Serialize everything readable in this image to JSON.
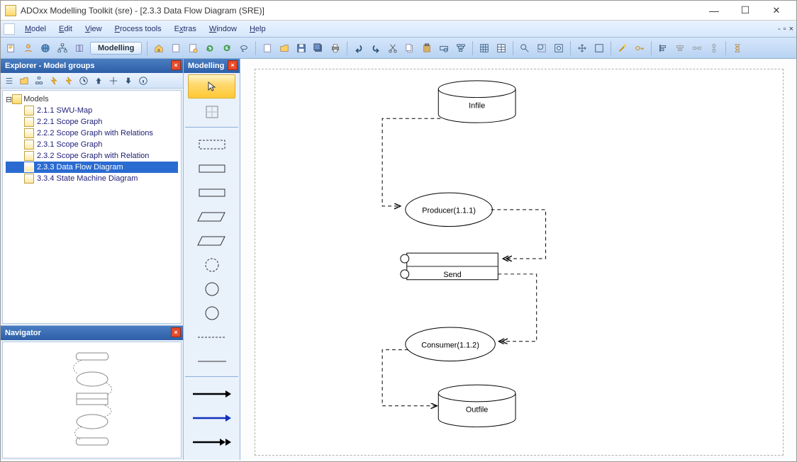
{
  "title": "ADOxx Modelling Toolkit (sre) - [2.3.3 Data Flow Diagram (SRE)]",
  "menus": [
    "Model",
    "Edit",
    "View",
    "Process tools",
    "Extras",
    "Window",
    "Help"
  ],
  "mode_label": "Modelling",
  "explorer": {
    "title": "Explorer - Model groups",
    "root": "Models",
    "items": [
      {
        "label": "2.1.1 SWU-Map",
        "selected": false
      },
      {
        "label": "2.2.1 Scope Graph",
        "selected": false
      },
      {
        "label": "2.2.2 Scope Graph with Relations",
        "selected": false
      },
      {
        "label": "2.3.1 Scope Graph",
        "selected": false
      },
      {
        "label": "2.3.2 Scope Graph with Relation",
        "selected": false
      },
      {
        "label": "2.3.3 Data Flow Diagram",
        "selected": true
      },
      {
        "label": "3.3.4 State Machine Diagram",
        "selected": false
      }
    ]
  },
  "navigator_title": "Navigator",
  "modelling_title": "Modelling",
  "diagram": {
    "nodes": {
      "infile": "Infile",
      "producer": "Producer(1.1.1)",
      "send": "Send",
      "consumer": "Consumer(1.1.2)",
      "outfile": "Outfile"
    }
  }
}
